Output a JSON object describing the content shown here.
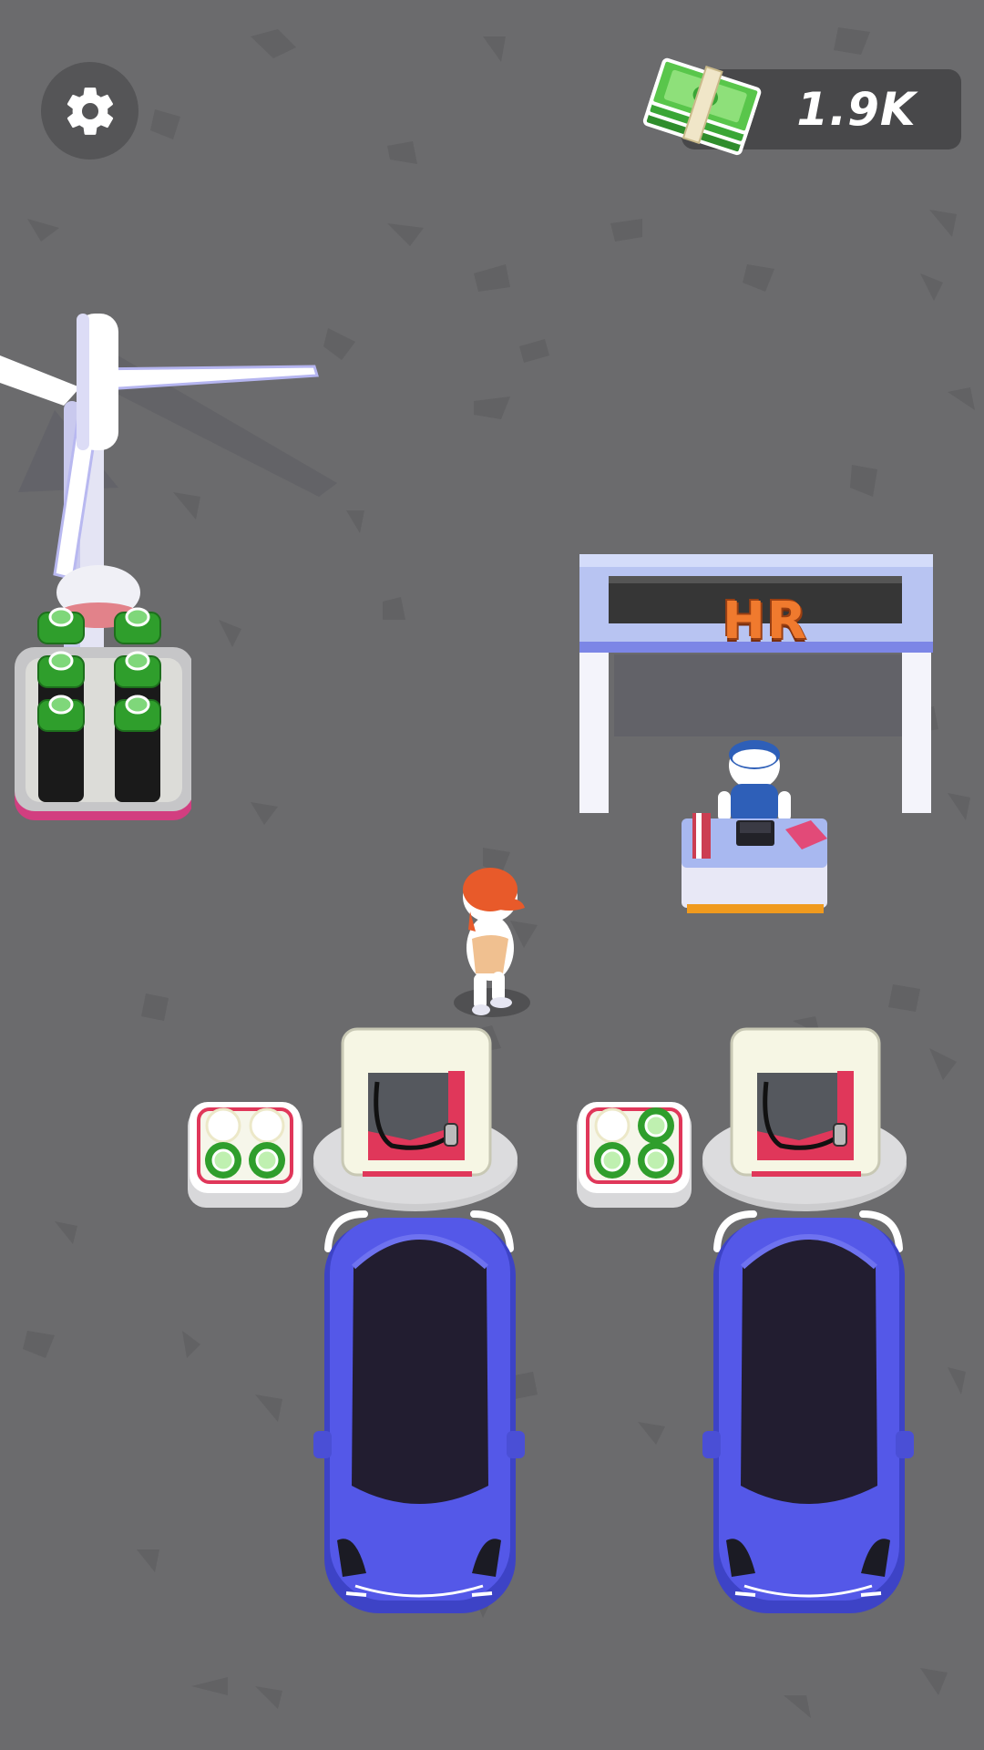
{
  "hud": {
    "settings_icon": "gear-icon",
    "currency_icon": "cash-stack-icon",
    "money": "1.9K"
  },
  "scene": {
    "hr_sign": "HR",
    "wind_turbine": "wind-turbine",
    "battery_rack": "battery-rack",
    "hr_desk": "hr-desk",
    "worker": "player-worker",
    "charging_stations": [
      "charging-station",
      "charging-station"
    ],
    "cars": [
      "blue-car",
      "blue-car"
    ]
  }
}
